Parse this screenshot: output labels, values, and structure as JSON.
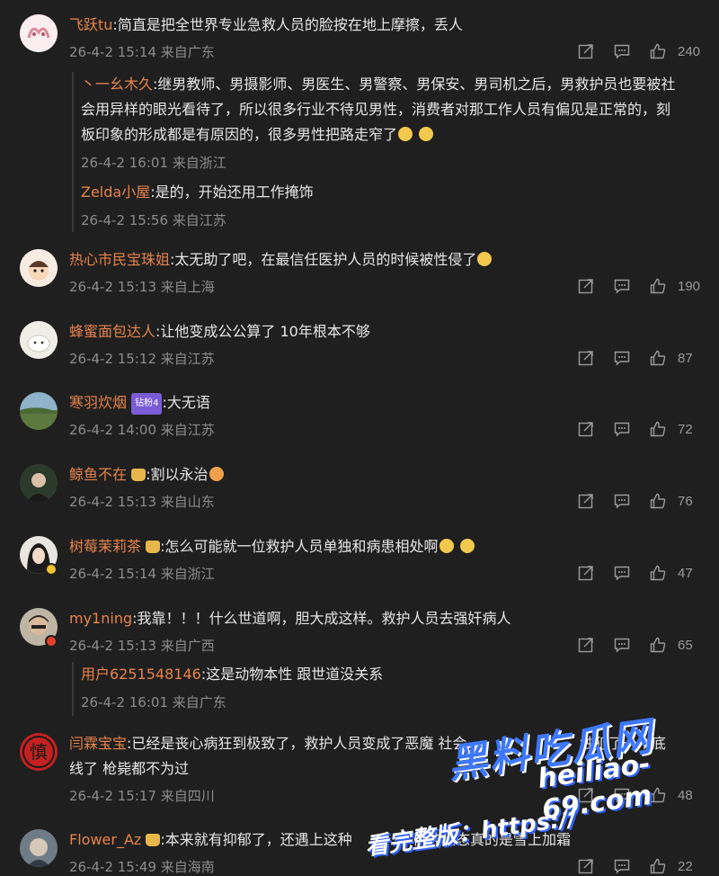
{
  "comments": [
    {
      "user": "飞跃tu",
      "text": ":简直是把全世界专业急救人员的脸按在地上摩擦，丢人",
      "time": "26-4-2 15:14",
      "location": "来自广东",
      "likes": "240",
      "replies": [
        {
          "user": "丶一幺木久",
          "text": ":继男教师、男摄影师、男医生、男警察、男保安、男司机之后，男救护员也要被社",
          "text2": "会用异样的眼光看待了，所以很多行业不待见男性，消费者对那工作人员有偏见是正常的，刻",
          "text3": "板印象的形成都是有原因的，很多男性把路走窄了",
          "time": "26-4-2 16:01",
          "location": "来自浙江"
        },
        {
          "user": "Zelda小屋",
          "text": ":是的，开始还用工作掩饰",
          "time": "26-4-2 15:56",
          "location": "来自江苏"
        }
      ]
    },
    {
      "user": "热心市民宝珠姐",
      "text": ":太无助了吧，在最信任医护人员的时候被性侵了",
      "time": "26-4-2 15:13",
      "location": "来自上海",
      "likes": "190"
    },
    {
      "user": "蜂蜜面包达人",
      "text": ":让他变成公公算了 10年根本不够",
      "time": "26-4-2 15:12",
      "location": "来自江苏",
      "likes": "87"
    },
    {
      "user": "寒羽炊烟",
      "badge": "钻粉4",
      "text": ":大无语",
      "time": "26-4-2 14:00",
      "location": "来自江苏",
      "likes": "72"
    },
    {
      "user": "鲸鱼不在",
      "text": ":割以永治",
      "time": "26-4-2 15:13",
      "location": "来自山东",
      "likes": "76"
    },
    {
      "user": "树莓茉莉茶",
      "text": ":怎么可能就一位救护人员单独和病患相处啊",
      "time": "26-4-2 15:14",
      "location": "来自浙江",
      "likes": "47"
    },
    {
      "user": "my1ning",
      "text": ":我靠！！！什么世道啊，胆大成这样。救护人员去强奸病人",
      "time": "26-4-2 15:13",
      "location": "来自广西",
      "likes": "65",
      "replies": [
        {
          "user": "用户6251548146",
          "text": ":这是动物本性 跟世道没关系",
          "time": "26-4-2 16:01",
          "location": "来自广东"
        }
      ]
    },
    {
      "user": "闫霖宝宝",
      "text": ":已经是丧心病狂到极致了，救护人员变成了恶魔 社会",
      "text_tail": "触犯了一个底",
      "text2": "线了 枪毙都不为过",
      "time": "26-4-2 15:17",
      "location": "来自四川",
      "likes": "48"
    },
    {
      "user": "Flower_Az",
      "text": ":本来就有抑郁了，还遇上这种",
      "text_tail": "精神状态真的是雪上加霜",
      "time": "26-4-2 15:49",
      "location": "来自海南",
      "likes": "22"
    }
  ],
  "watermark": {
    "line1": "黑料吃瓜网",
    "line2": "heiliao-69.com",
    "line3": "看完整版：https://"
  }
}
